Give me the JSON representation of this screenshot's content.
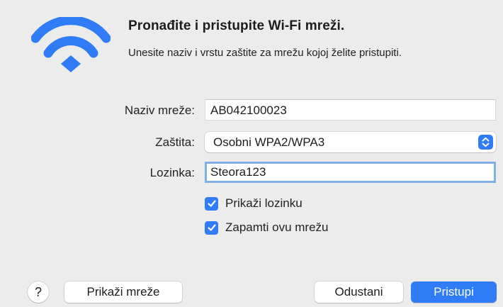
{
  "header": {
    "title": "Pronađite i pristupite Wi-Fi mreži.",
    "subtitle": "Unesite naziv i vrstu zaštite za mrežu kojoj želite pristupiti.",
    "icon": "wifi-icon"
  },
  "form": {
    "network_name_label": "Naziv mreže:",
    "network_name_value": "AB042100023",
    "security_label": "Zaštita:",
    "security_value": "Osobni WPA2/WPA3",
    "password_label": "Lozinka:",
    "password_value": "Steora123",
    "show_password_label": "Prikaži lozinku",
    "show_password_checked": true,
    "remember_network_label": "Zapamti ovu mrežu",
    "remember_network_checked": true
  },
  "footer": {
    "help_label": "?",
    "show_networks_label": "Prikaži mreže",
    "cancel_label": "Odustani",
    "join_label": "Pristupi"
  },
  "colors": {
    "accent": "#2f7cf6",
    "background": "#ececec",
    "focus_ring": "#7fb0ea"
  }
}
